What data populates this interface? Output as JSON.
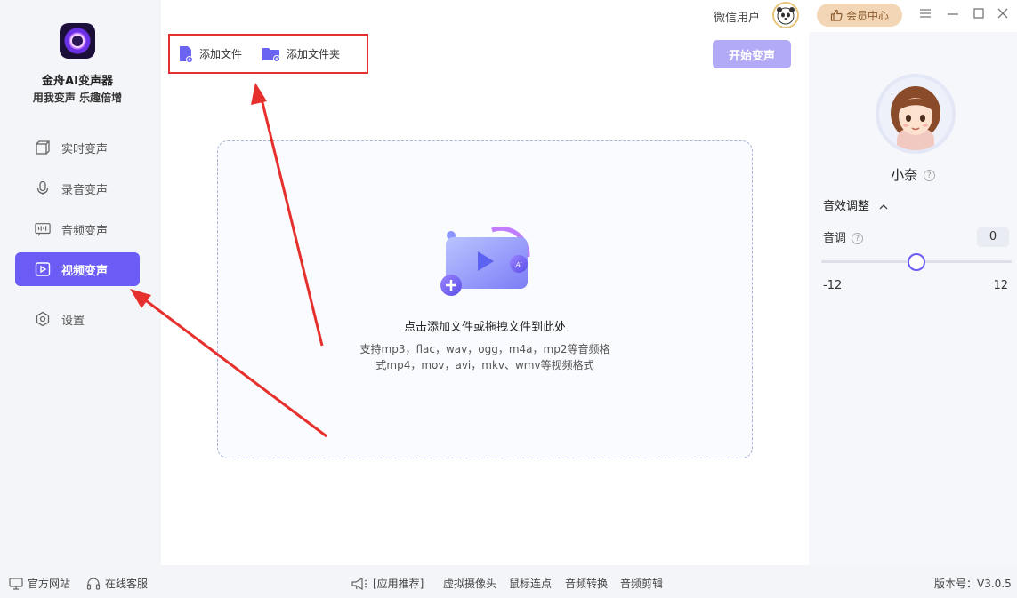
{
  "app": {
    "name": "金舟AI变声器",
    "slogan": "用我变声 乐趣倍增"
  },
  "sidebar": {
    "items": [
      {
        "label": "实时变声",
        "icon": "cube-icon"
      },
      {
        "label": "录音变声",
        "icon": "microphone-icon"
      },
      {
        "label": "音频变声",
        "icon": "waveform-icon"
      },
      {
        "label": "视频变声",
        "icon": "play-icon",
        "active": true
      },
      {
        "label": "设置",
        "icon": "settings-icon"
      }
    ]
  },
  "toolbar": {
    "add_file": "添加文件",
    "add_folder": "添加文件夹",
    "start": "开始变声"
  },
  "dropzone": {
    "title": "点击添加文件或拖拽文件到此处",
    "hint_line1": "支持mp3，flac，wav，ogg，m4a，mp2等音频格",
    "hint_line2": "式mp4，mov，avi，mkv、wmv等视频格式"
  },
  "topbar": {
    "user": "微信用户",
    "vip": "会员中心"
  },
  "voice": {
    "name": "小奈"
  },
  "effects": {
    "section_title": "音效调整",
    "pitch_label": "音调",
    "pitch_value": "0",
    "pitch_min": "-12",
    "pitch_max": "12",
    "pitch_fraction": 0.5
  },
  "footer": {
    "website": "官方网站",
    "support": "在线客服",
    "recommend": "[应用推荐]",
    "links": [
      "虚拟摄像头",
      "鼠标连点",
      "音频转换",
      "音频剪辑"
    ],
    "version": "版本号：V3.0.5"
  },
  "colors": {
    "accent": "#6a5cf5",
    "annotation": "#e6302d",
    "vip_bg": "#f3d6b6"
  }
}
